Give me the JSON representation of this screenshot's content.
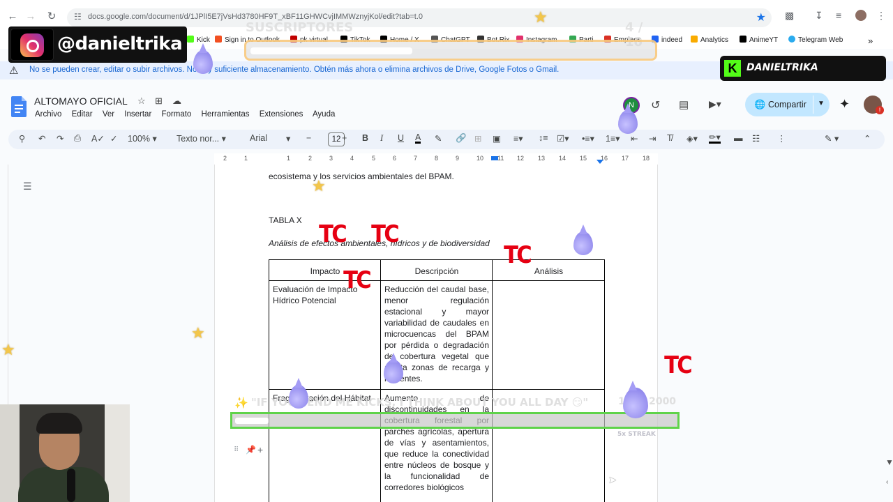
{
  "browser": {
    "url": "docs.google.com/document/d/1JPlI5E7jVsHd3780HF9T_xBF11GHWCvjIMMWznyjKol/edit?tab=t.0",
    "bookmarks": [
      {
        "label": "Kick",
        "color": "#53fc18"
      },
      {
        "label": "Sign in to Outlook",
        "color": "#f25022"
      },
      {
        "label": "pk virtual",
        "color": "#c00000"
      },
      {
        "label": "TikTok",
        "color": "#000000"
      },
      {
        "label": "Home / X",
        "color": "#000000"
      },
      {
        "label": "ChatGPT",
        "color": "#555555"
      },
      {
        "label": "Bot.Rix",
        "color": "#333333"
      },
      {
        "label": "Instagram",
        "color": "#e1306c"
      },
      {
        "label": "Parti",
        "color": "#34a853"
      },
      {
        "label": "Empleos",
        "color": "#d93025"
      },
      {
        "label": "indeed",
        "color": "#2164f3"
      },
      {
        "label": "Analytics",
        "color": "#f9ab00"
      },
      {
        "label": "AnimeYT",
        "color": "#000000"
      },
      {
        "label": "Telegram Web",
        "color": "#2aabee"
      }
    ]
  },
  "banner": {
    "message": "No se pueden crear, editar o subir archivos. No hay suficiente almacenamiento. Obtén más ahora o elimina archivos de Drive, Google Fotos o Gmail."
  },
  "docs": {
    "title": "ALTOMAYO OFICIAL",
    "menu": [
      "Archivo",
      "Editar",
      "Ver",
      "Insertar",
      "Formato",
      "Herramientas",
      "Extensiones",
      "Ayuda"
    ],
    "avatar_letter": "N",
    "share_label": "Compartir"
  },
  "toolbar": {
    "zoom": "100%",
    "style": "Texto nor...",
    "font": "Arial",
    "font_size": "12"
  },
  "ruler": [
    "2",
    "1",
    "1",
    "2",
    "3",
    "4",
    "5",
    "6",
    "7",
    "8",
    "9",
    "10",
    "11",
    "12",
    "13",
    "14",
    "15",
    "16",
    "17",
    "18"
  ],
  "document": {
    "text_top": "ecosistema y los servicios ambientales del BPAM.",
    "table_label": "TABLA X",
    "caption": "Análisis de efectos ambientales, hídricos y de biodiversidad",
    "table": {
      "headers": [
        "Impacto",
        "Descripción",
        "Análisis"
      ],
      "rows": [
        {
          "impacto": "Evaluación de Impacto Hídrico Potencial",
          "descripcion": "Reducción del caudal base, menor regulación estacional y mayor variabilidad de caudales en microcuencas del BPAM por pérdida o degradación de cobertura vegetal que afecta zonas de recarga y nacientes.",
          "analisis": ""
        },
        {
          "impacto": "Fragmentación del Hábitat",
          "descripcion": "Aumento de discontinuidades en la cobertura forestal por parches agrícolas, apertura de vías y asentamientos, que reduce la conectividad entre núcleos de bosque y la funcionalidad de corredores biológicos",
          "analisis": ""
        }
      ]
    }
  },
  "overlay": {
    "instagram_handle": "@danieltrika",
    "kick_name": "DANIELTRIKA",
    "subs_label": "SUSCRIPTORES",
    "subs_count": "4 / 10",
    "subs_progress": 0.4,
    "goal_message": "\"IF YOU SEND ME KICKS, I THINK ABOUT YOU ALL DAY 😏\"",
    "goal_count": "152 / 2000",
    "goal_progress": 0.076,
    "streak": "5x STREAK",
    "tc_text": "TC"
  }
}
